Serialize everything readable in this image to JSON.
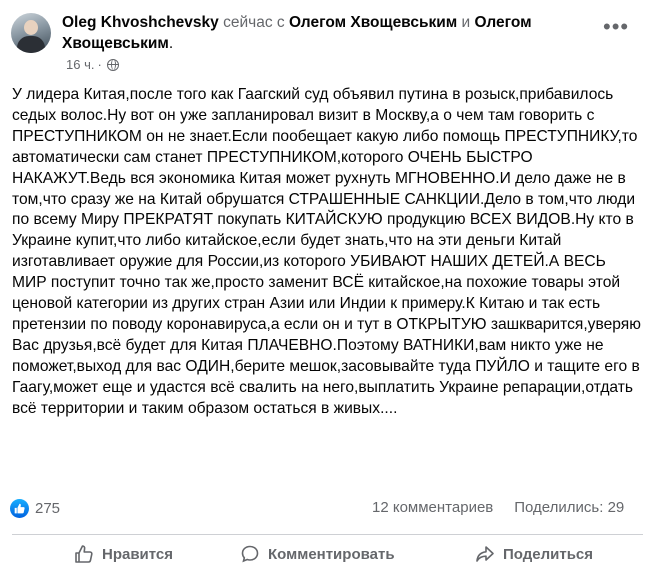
{
  "post": {
    "author": "Oleg Khvoshchevsky",
    "connector": "сейчас с",
    "tagged_1": "Олегом Хвощевським",
    "conj": "и",
    "tagged_2": "Олегом Хвощевським",
    "end_dot": ".",
    "time": "16 ч.",
    "sep": "·",
    "text": "У лидера Китая,после того как Гаагский суд объявил путина в розыск,прибавилось седых волос.Ну вот он уже запланировал визит в Москву,а о чем там говорить с ПРЕСТУПНИКОМ он не знает.Если пообещает какую либо помощь ПРЕСТУПНИКУ,то автоматически сам станет ПРЕСТУПНИКОМ,которого ОЧЕНЬ БЫСТРО НАКАЖУТ.Ведь вся экономика Китая может рухнуть МГНОВЕННО.И дело даже не в том,что сразу же на Китай обрушатся СТРАШЕННЫЕ САНКЦИИ.Дело в том,что люди по всему Миру ПРЕКРАТЯТ покупать КИТАЙСКУЮ продукцию ВСЕХ ВИДОВ.Ну кто в Украине купит,что либо китайское,если будет знать,что на эти деньги Китай изготавливает оружие для России,из которого УБИВАЮТ НАШИХ ДЕТЕЙ.А ВЕСЬ МИР поступит точно так же,просто заменит ВСЁ китайское,на похожие товары этой ценовой категории из других стран Азии или Индии к примеру.К Китаю и так есть претензии по поводу коронавируса,а если он и тут в ОТКРЫТУЮ зашкварится,уверяю Вас друзья,всё будет для Китая ПЛАЧЕВНО.Поэтому ВАТНИКИ,вам никто уже не поможет,выход для вас ОДИН,берите мешок,засовывайте туда ПУЙЛО и тащите его в Гаагу,может еще и удастся всё свалить на него,выплатить Украине репарации,отдать всё территории и таким образом остаться в живых...."
  },
  "stats": {
    "reaction_count": "275",
    "comments": "12 комментариев",
    "shares": "Поделились: 29"
  },
  "actions": {
    "like": "Нравится",
    "comment": "Комментировать",
    "share": "Поделиться"
  },
  "colors": {
    "text": "#050505",
    "secondary": "#65676b",
    "like_blue": "#0a7cff",
    "divider": "#ced0d4"
  },
  "icons": [
    "avatar",
    "globe-icon",
    "more-icon",
    "like-reaction-icon",
    "thumbs-up-icon",
    "comment-icon",
    "share-icon"
  ]
}
